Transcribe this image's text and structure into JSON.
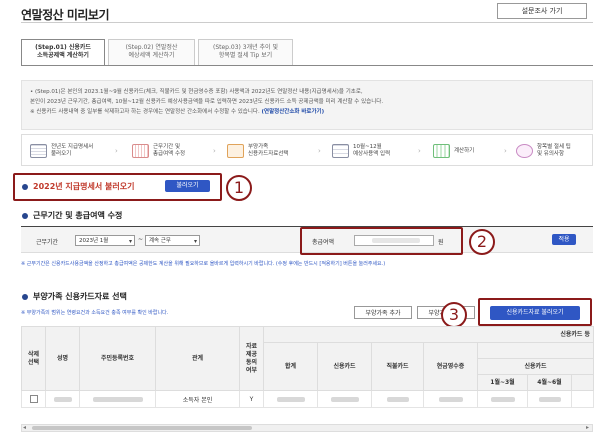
{
  "header": {
    "title": "연말정산 미리보기",
    "survey_button": "설문조사 가기"
  },
  "tabs": [
    {
      "line1": "(Step.01) 신용카드",
      "line2": "소득공제액 계산하기"
    },
    {
      "line1": "(Step.02) 연말정산",
      "line2": "예상세액 계산하기"
    },
    {
      "line1": "(Step.03) 3개년 추이 및",
      "line2": "항목별 절세 Tip 보기"
    }
  ],
  "notice": {
    "line1": "• (Step.01)은 본인의 2023.1월~9월 신용카드(체크, 직불카드 및 현금영수증 포함) 사용액과 2022년도 연말정산 내용(지급명세서)을 기초로,",
    "line2": "  본인이 2023년 근무기간, 총급여액, 10월~12월 신용카드 예상사용금액을 따로 입력하면 2023년도 신용카드 소득 공제금액을 미리 계산할 수 있습니다.",
    "line3_pre": "※ 신용카드 사용내역 중 일부를 삭제하고자 하는 경우에는 연말정산 간소화에서 수정할 수 있습니다. ",
    "line3_link": "(연말정산간소화 바로가기)"
  },
  "steps": [
    {
      "line1": "전년도 지급명세서",
      "line2": "불러오기",
      "icon": "document-icon",
      "color": "#8a8fa3"
    },
    {
      "line1": "근무기간 및",
      "line2": "총급여액 수정",
      "icon": "calendar-icon",
      "color": "#d98c8c"
    },
    {
      "line1": "부양가족",
      "line2": "신용카드자료선택",
      "icon": "monitor-icon",
      "color": "#e0a35a"
    },
    {
      "line1": "10월~12월",
      "line2": "예상사용액 입력",
      "icon": "form-icon",
      "color": "#8a8fa3"
    },
    {
      "line1": "계산하기",
      "line2": "",
      "icon": "calculator-icon",
      "color": "#6fbf7a"
    },
    {
      "line1": "항목별 절세 팁",
      "line2": "및 유의사항",
      "icon": "tip-icon",
      "color": "#c98bc4"
    }
  ],
  "section1": {
    "title": "2022년 지급명세서 불러오기",
    "button": "불러오기"
  },
  "section2": {
    "title": "근무기간 및 총급여액 수정",
    "period_label": "근무기간",
    "start_value": "2023년 1월",
    "end_value": "계속 근무",
    "amount_label": "총급여액",
    "amount_value": "",
    "unit": "원",
    "apply_button": "적용",
    "note": "※ 근무기간은 신용카드사용금액을 산정하고 총급여액은 공제한도 계산을 위해 필요하므로 올바르게 입력하시기 바랍니다. (수정 후에는 반드시 [적용하기] 버튼을 눌러주세요.)"
  },
  "section3": {
    "title": "부양가족 신용카드자료 선택",
    "note": "※ 부양가족의 범위는 연령요건과 소득요건 충족 여부를 확인 바랍니다.",
    "add_button": "부양가족 추가",
    "delete_button": "부양가족 삭제",
    "load_button": "신용카드자료 불러오기"
  },
  "table": {
    "headers": {
      "delete": "삭제\n선택",
      "name": "성명",
      "rrn": "주민등록번호",
      "relation": "관계",
      "consent": "자료\n제공\n동의\n여부",
      "total": "합계",
      "credit": "신용카드",
      "debit": "직불카드",
      "cash": "현금영수증",
      "credit_group": "신용카드 등",
      "sub_credit": "신용카드",
      "month1": "1월~3월",
      "month2": "4월~6월"
    },
    "row": {
      "relation": "소득자 본인",
      "consent": "Y"
    }
  },
  "markers": [
    "1",
    "2",
    "3"
  ],
  "colors": {
    "accent": "#2f57c4",
    "marker": "#8b1a1a",
    "section1_title": "#c0392b"
  }
}
